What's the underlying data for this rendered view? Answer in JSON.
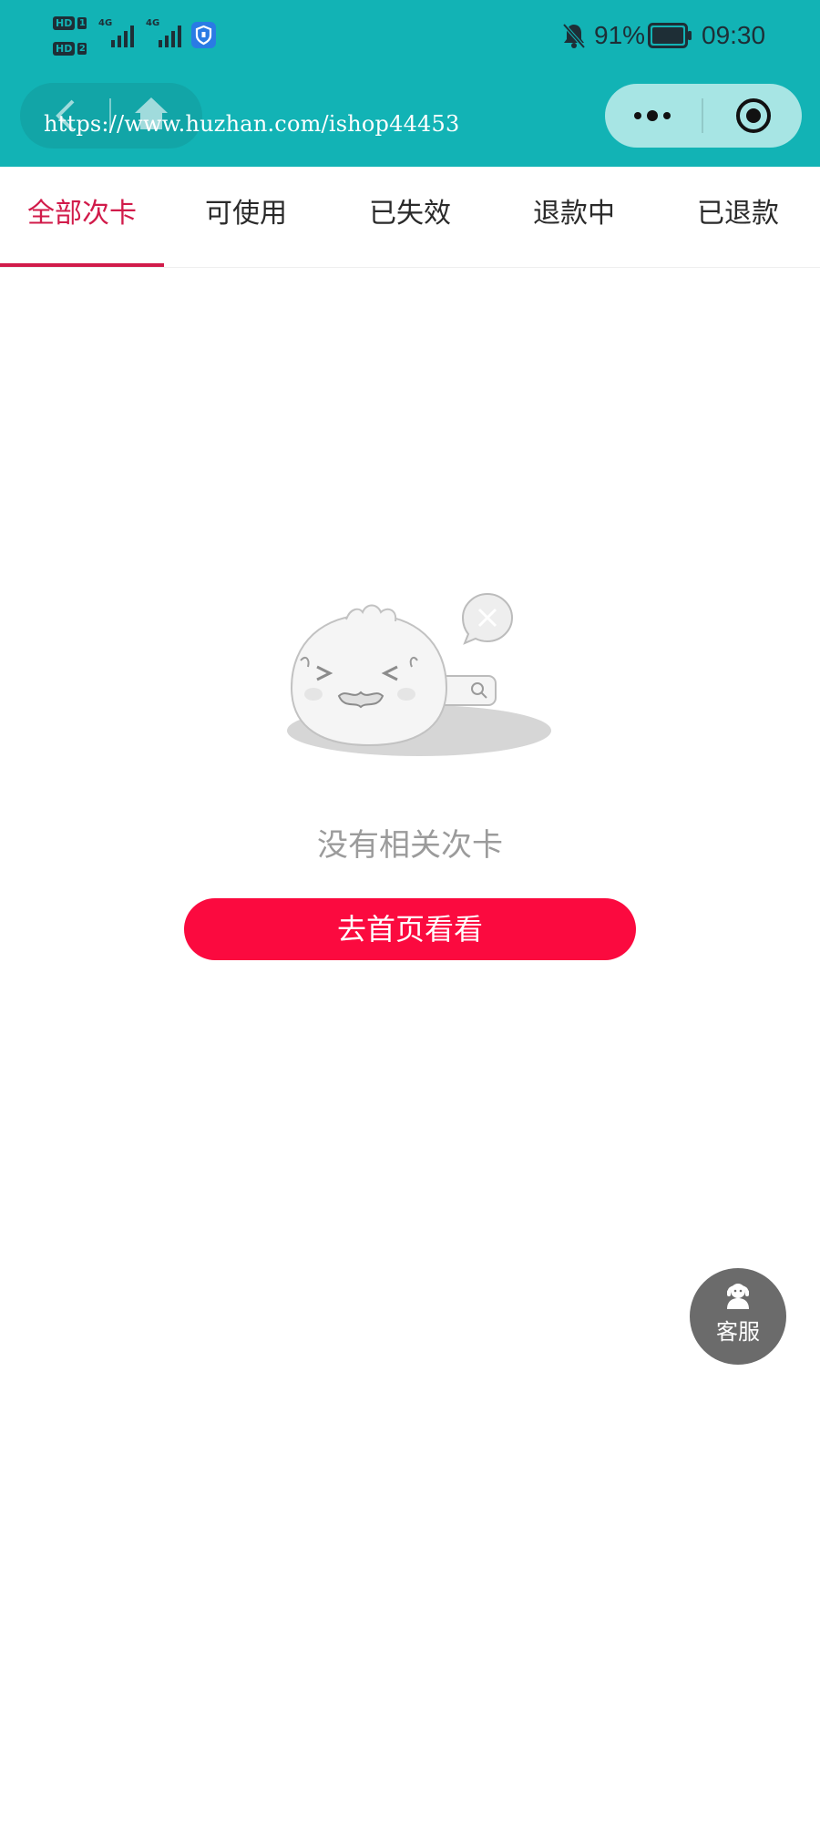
{
  "status_bar": {
    "sim1_label": "HD",
    "sim1_num": "1",
    "sim2_label": "HD",
    "sim2_num": "2",
    "network1": "4G",
    "network2": "4G",
    "battery_percent": "91%",
    "time": "09:30",
    "icons": [
      "sim-badge-icon",
      "signal-bars-icon",
      "app-shield-icon",
      "bell-muted-icon",
      "battery-icon"
    ]
  },
  "nav": {
    "watermark": "https://www.huzhan.com/ishop44453",
    "icons": [
      "back-arrow-icon",
      "home-icon",
      "more-dots-icon",
      "close-target-icon"
    ]
  },
  "tabs": [
    {
      "label": "全部次卡",
      "active": true
    },
    {
      "label": "可使用",
      "active": false
    },
    {
      "label": "已失效",
      "active": false
    },
    {
      "label": "退款中",
      "active": false
    },
    {
      "label": "已退款",
      "active": false
    }
  ],
  "empty_state": {
    "message": "没有相关次卡",
    "button_label": "去首页看看",
    "illustration": "empty-bun-icon"
  },
  "service": {
    "label": "客服",
    "icon": "customer-service-icon"
  },
  "colors": {
    "header_bg": "#12b3b5",
    "accent": "#d11b4a",
    "button_bg": "#fb0a3f",
    "fab_bg": "#6b6b6b"
  }
}
